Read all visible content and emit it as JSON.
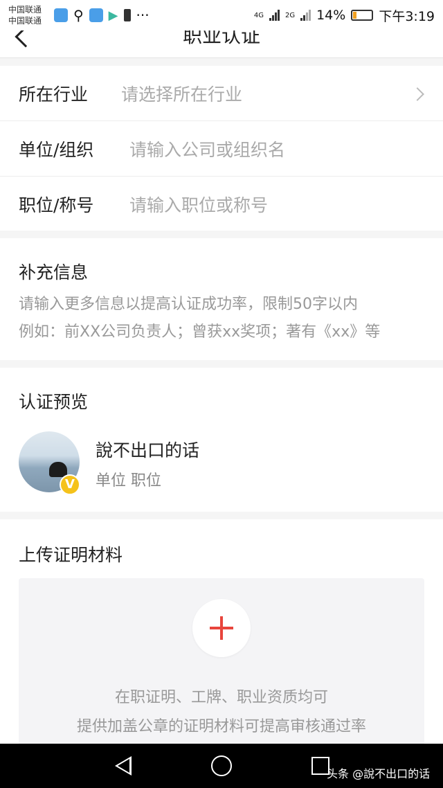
{
  "status_bar": {
    "carrier_1": "中国联通",
    "carrier_2": "中国联通",
    "network_1": "4G",
    "network_2": "2G",
    "battery": "14%",
    "time": "下午3:19"
  },
  "header": {
    "title": "职业认证"
  },
  "form": {
    "industry_label": "所在行业",
    "industry_placeholder": "请选择所在行业",
    "org_label": "单位/组织",
    "org_placeholder": "请输入公司或组织名",
    "position_label": "职位/称号",
    "position_placeholder": "请输入职位或称号"
  },
  "supplement": {
    "title": "补充信息",
    "placeholder_line1": "请输入更多信息以提高认证成功率，限制50字以内",
    "placeholder_line2": "例如：前XX公司负责人；曾获xx奖项；著有《xx》等"
  },
  "preview": {
    "title": "认证预览",
    "username": "說不出口的话",
    "subtitle": "单位 职位",
    "badge": "V"
  },
  "upload": {
    "title": "上传证明材料",
    "hint_line1": "在职证明、工牌、职业资质均可",
    "hint_line2": "提供加盖公章的证明材料可提高审核通过率"
  },
  "watermark": "头条 @說不出口的话",
  "colors": {
    "accent": "#e8453c",
    "badge": "#f5c21b",
    "placeholder": "#aaaaaa",
    "background": "#f5f5f5"
  }
}
